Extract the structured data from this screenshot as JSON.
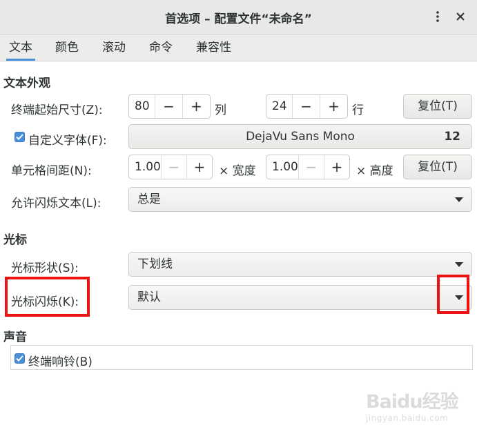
{
  "window": {
    "title": "首选项 – 配置文件“未命名”",
    "menu_icon": "kebab-menu-icon",
    "close_icon": "close-icon"
  },
  "tabs": [
    {
      "label": "文本",
      "active": true
    },
    {
      "label": "颜色",
      "active": false
    },
    {
      "label": "滚动",
      "active": false
    },
    {
      "label": "命令",
      "active": false
    },
    {
      "label": "兼容性",
      "active": false
    }
  ],
  "text_appearance": {
    "heading": "文本外观",
    "initial_size": {
      "label": "终端起始尺寸(Z):",
      "columns": "80",
      "columns_unit": "列",
      "rows": "24",
      "rows_unit": "行",
      "reset_label": "复位(T)"
    },
    "custom_font": {
      "checked": true,
      "label": "自定义字体(F):",
      "font_name": "DejaVu Sans Mono",
      "font_size": "12"
    },
    "cell_spacing": {
      "label": "单元格间距(N):",
      "width_value": "1.00",
      "width_unit": "× 宽度",
      "height_value": "1.00",
      "height_unit": "× 高度",
      "reset_label": "复位(T)"
    },
    "blink_text": {
      "label": "允许闪烁文本(L):",
      "value": "总是"
    }
  },
  "cursor": {
    "heading": "光标",
    "shape": {
      "label": "光标形状(S):",
      "value": "下划线"
    },
    "blink": {
      "label": "光标闪烁(K):",
      "value": "默认"
    }
  },
  "sound": {
    "heading": "声音",
    "bell": {
      "checked": true,
      "label": "终端响铃(B)"
    }
  },
  "spin_glyphs": {
    "minus": "−",
    "plus": "+"
  },
  "watermark": {
    "main": "Baidu经验",
    "sub": "jingyan.baidu.com"
  },
  "colors": {
    "accent": "#4a90d9",
    "highlight": "#ee1111"
  }
}
